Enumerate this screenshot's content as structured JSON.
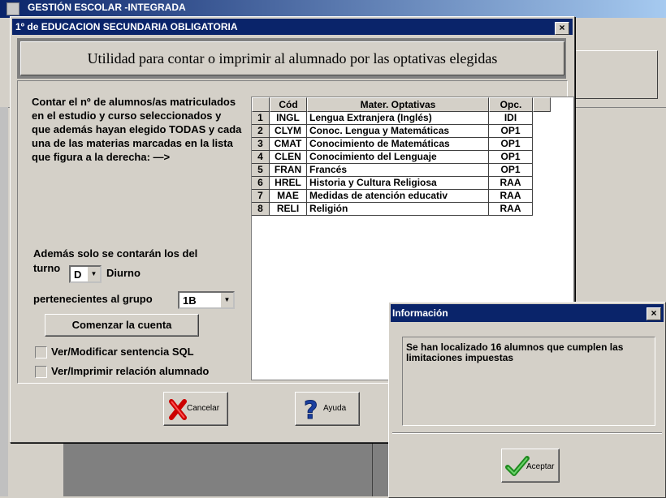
{
  "background": {
    "title": "GESTIÓN ESCOLAR -INTEGRADA"
  },
  "dialog": {
    "title": "1º de EDUCACION SECUNDARIA OBLIGATORIA",
    "close_glyph": "×",
    "header": "Utilidad para contar o imprimir al alumnado por las optativas elegidas",
    "description": "Contar el nº de alumnos/as matriculados en el estudio y curso seleccionados y que además hayan elegido TODAS y cada una de las materias marcadas en la lista que figura a la derecha: —>",
    "ademas_label": "Además solo se contarán los del",
    "turno_label": "turno",
    "turno_value": "D",
    "turno_text": "Diurno",
    "grupo_label": "pertenecientes al grupo",
    "grupo_value": "1B",
    "comenzar_label": "Comenzar la cuenta",
    "check_sql_label": "Ver/Modificar sentencia SQL",
    "check_relacion_label": "Ver/Imprimir relación alumnado",
    "cancel_label": "Cancelar",
    "help_label": "Ayuda"
  },
  "grid": {
    "headers": [
      "",
      "Cód",
      "Mater. Optativas",
      "Opc."
    ],
    "rows": [
      {
        "n": "1",
        "cod": "INGL",
        "mat": "Lengua Extranjera (Inglés)",
        "opc": "IDI"
      },
      {
        "n": "2",
        "cod": "CLYM",
        "mat": "Conoc. Lengua y Matemáticas",
        "opc": "OP1"
      },
      {
        "n": "3",
        "cod": "CMAT",
        "mat": "Conocimiento de Matemáticas",
        "opc": "OP1"
      },
      {
        "n": "4",
        "cod": "CLEN",
        "mat": "Conocimiento del Lenguaje",
        "opc": "OP1"
      },
      {
        "n": "5",
        "cod": "FRAN",
        "mat": "Francés",
        "opc": "OP1"
      },
      {
        "n": "6",
        "cod": "HREL",
        "mat": "Historia y Cultura Religiosa",
        "opc": "RAA"
      },
      {
        "n": "7",
        "cod": "MAE",
        "mat": "Medidas de atención educativ",
        "opc": "RAA"
      },
      {
        "n": "8",
        "cod": "RELI",
        "mat": "Religión",
        "opc": "RAA"
      }
    ]
  },
  "info": {
    "title": "Información",
    "close_glyph": "×",
    "message": "Se han localizado 16 alumnos que cumplen las limitaciones impuestas",
    "ok_label": "Aceptar"
  },
  "icons": {
    "cancel": "red-x-icon",
    "help": "question-icon",
    "ok": "green-check-icon"
  },
  "colors": {
    "titlebar": "#0a246a",
    "face": "#d4d0c8"
  }
}
